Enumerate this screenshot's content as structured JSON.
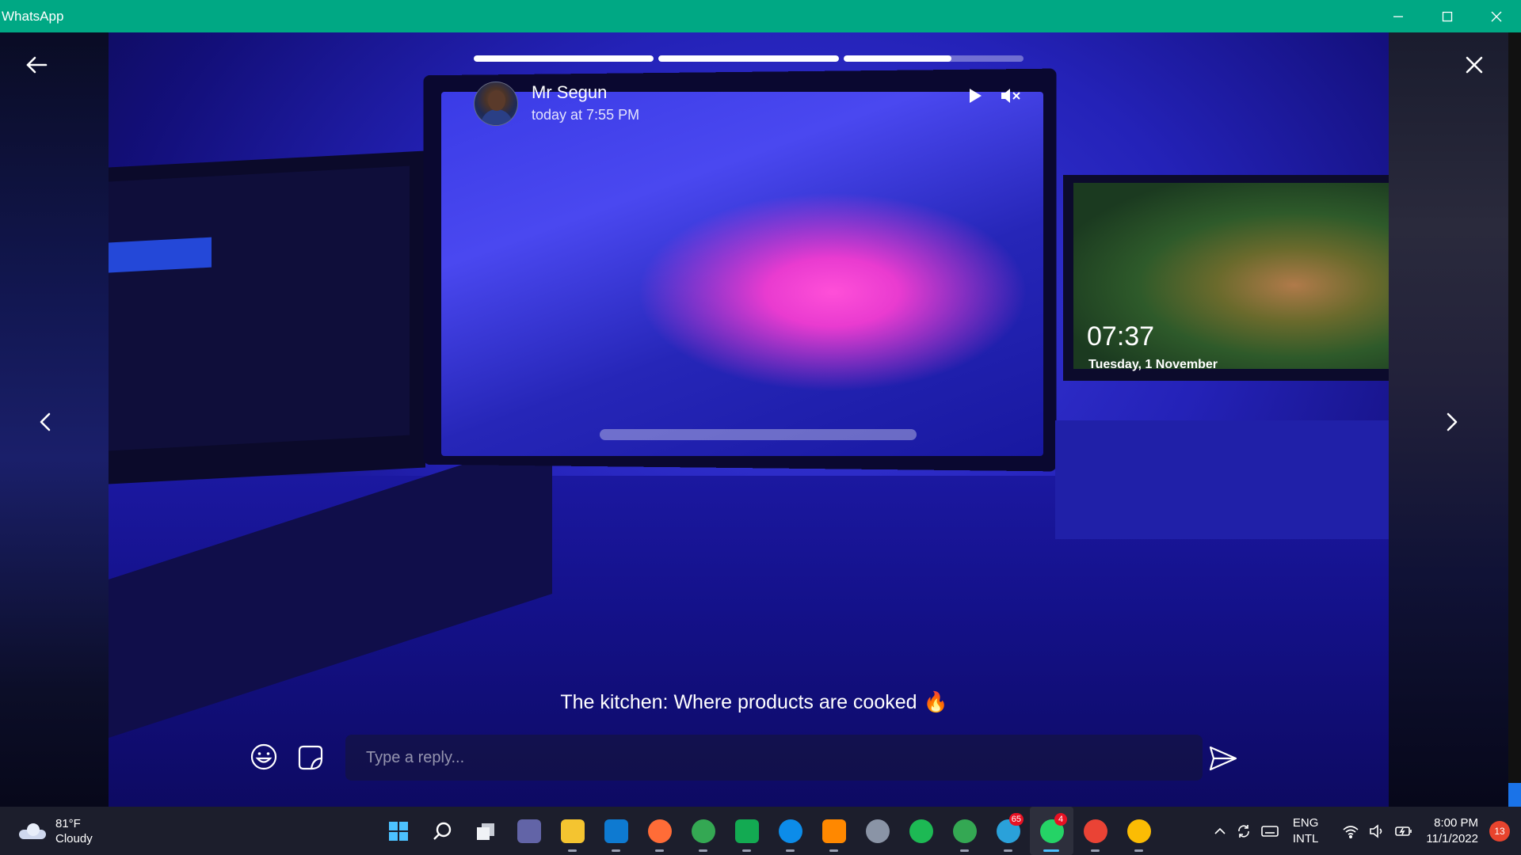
{
  "window": {
    "title": "WhatsApp",
    "controls": {
      "minimize": "minimize-icon",
      "maximize": "maximize-icon",
      "close": "close-icon"
    }
  },
  "status": {
    "contact_name": "Mr Segun",
    "posted_time": "today at 7:55 PM",
    "progress": [
      1.0,
      1.0,
      0.6
    ],
    "caption": "The kitchen: Where products are cooked",
    "caption_emoji": "🔥",
    "photo_overlay": {
      "lock_time": "07:37",
      "lock_date": "Tuesday, 1 November"
    }
  },
  "reply": {
    "placeholder": "Type a reply..."
  },
  "taskbar": {
    "weather": {
      "temp": "81°F",
      "condition": "Cloudy"
    },
    "apps": [
      {
        "name": "windows-start-icon",
        "label": "",
        "color": "#2f8ff0",
        "badge": ""
      },
      {
        "name": "search-icon",
        "label": "",
        "color": "",
        "badge": ""
      },
      {
        "name": "task-view-icon",
        "label": "",
        "color": "",
        "badge": ""
      },
      {
        "name": "teams-chat-icon",
        "label": "",
        "color": "#6264a7",
        "badge": ""
      },
      {
        "name": "file-explorer-icon",
        "label": "",
        "color": "#f4c430",
        "badge": ""
      },
      {
        "name": "vscode-icon",
        "label": "",
        "color": "#0e7ad1",
        "badge": ""
      },
      {
        "name": "postman-icon",
        "label": "",
        "color": "#ff6c37",
        "badge": ""
      },
      {
        "name": "chrome-icon",
        "label": "",
        "color": "#34a853",
        "badge": ""
      },
      {
        "name": "mongodb-compass-icon",
        "label": "",
        "color": "#13aa52",
        "badge": ""
      },
      {
        "name": "edge-icon",
        "label": "",
        "color": "#0c8ce9",
        "badge": ""
      },
      {
        "name": "vlc-icon",
        "label": "",
        "color": "#ff8800",
        "badge": ""
      },
      {
        "name": "settings-icon",
        "label": "",
        "color": "#8a94a6",
        "badge": ""
      },
      {
        "name": "spotify-icon",
        "label": "",
        "color": "#1db954",
        "badge": ""
      },
      {
        "name": "chrome-profile-icon",
        "label": "",
        "color": "#34a853",
        "badge": ""
      },
      {
        "name": "telegram-icon",
        "label": "",
        "color": "#2aa1da",
        "badge": "65"
      },
      {
        "name": "whatsapp-icon",
        "label": "",
        "color": "#25d366",
        "badge": "4"
      },
      {
        "name": "chrome-dev-icon",
        "label": "",
        "color": "#ea4335",
        "badge": ""
      },
      {
        "name": "chrome-canary-icon",
        "label": "",
        "color": "#fbbc04",
        "badge": ""
      }
    ],
    "active_app": "whatsapp-icon",
    "language": {
      "line1": "ENG",
      "line2": "INTL"
    },
    "clock": {
      "time": "8:00 PM",
      "date": "11/1/2022"
    },
    "notifications": "13"
  },
  "colors": {
    "titlebar": "#00a884",
    "taskbar": "#1c1e2c"
  }
}
